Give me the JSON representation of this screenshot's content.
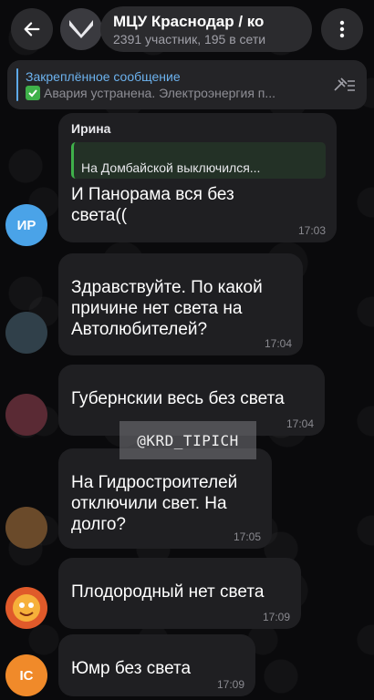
{
  "header": {
    "title": "МЦУ Краснодар / ко",
    "subtitle": "2391 участник, 195 в сети"
  },
  "pinned": {
    "label": "Закреплённое сообщение",
    "text": "Авария устранена. Электроэнергия п..."
  },
  "messages": [
    {
      "sender": "Ирина",
      "reply_name": "",
      "reply_text": "На Домбайской выключился...",
      "text": "И Панорама вся без света((",
      "time": "17:03",
      "avatar_initials": "ИР",
      "avatar_color": "#4aa3e8"
    },
    {
      "sender": "",
      "text": "Здравствуйте. По какой причине нет света на Автолюбителей?",
      "time": "17:04",
      "avatar_color": "#30404a"
    },
    {
      "sender": "",
      "text": "Губернскии весь без света",
      "time": "17:04",
      "avatar_color": "#5a2a34"
    },
    {
      "sender": "",
      "text": "На Гидростроителей отключили свет. На долго?",
      "time": "17:05",
      "avatar_color": "#6a4a2a"
    },
    {
      "sender": "",
      "text": "Плодородный нет света",
      "time": "17:09",
      "avatar_color": "#e05a2a"
    },
    {
      "sender": "",
      "text": "Юмр без света",
      "time": "17:09",
      "avatar_initials": "IC",
      "avatar_color": "#f08a2a"
    }
  ],
  "watermark": "@KRD_TIPICH",
  "colors": {
    "accent": "#5ea9e8",
    "bubble": "#1f1f22",
    "reply": "#3fb14a"
  }
}
